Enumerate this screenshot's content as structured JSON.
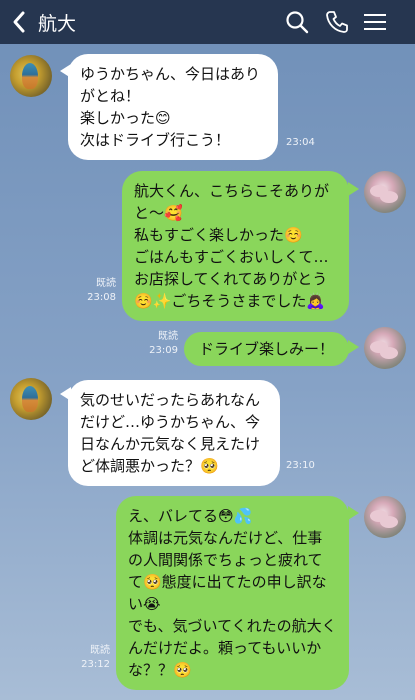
{
  "header": {
    "title": "航大",
    "back_icon": "chevron-left-icon",
    "search_icon": "search-icon",
    "call_icon": "phone-icon",
    "menu_icon": "menu-icon"
  },
  "colors": {
    "header_bg": "#263650",
    "bubble_sent": "#8ad65b",
    "bubble_received": "#ffffff",
    "background": "#7a98bf"
  },
  "messages": [
    {
      "side": "left",
      "text": "ゆうかちゃん、今日はありがとね！\n楽しかった😊\n次はドライブ行こう！",
      "time": "23:04"
    },
    {
      "side": "right",
      "text": "航大くん、こちらこそありがと〜🥰\n私もすごく楽しかった☺️\nごはんもすごくおいしくて…\nお店探してくれてありがとう☺️✨ごちそうさまでした🙇‍♀️",
      "read": "既読",
      "time": "23:08"
    },
    {
      "side": "right",
      "text": "ドライブ楽しみー！",
      "read": "既読",
      "time": "23:09"
    },
    {
      "side": "left",
      "text": "気のせいだったらあれなんだけど…ゆうかちゃん、今日なんか元気なく見えたけど体調悪かった？🥺",
      "time": "23:10"
    },
    {
      "side": "right",
      "text": "え、バレてる😳💦\n体調は元気なんだけど、仕事の人間関係でちょっと疲れてて🥺態度に出てたの申し訳ない😭\nでも、気づいてくれたの航大くんだけだよ。頼ってもいいかな？？🥺",
      "read": "既読",
      "time": "23:12"
    }
  ]
}
